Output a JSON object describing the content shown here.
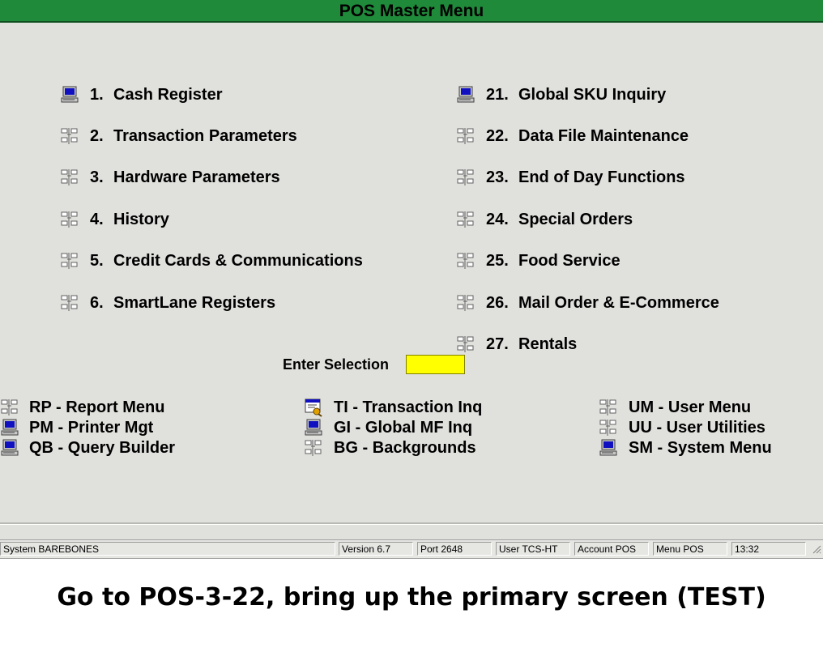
{
  "window": {
    "title": "POS Master Menu"
  },
  "menu_left": [
    {
      "num": "1.",
      "label": "Cash Register",
      "icon": "computer-icon"
    },
    {
      "num": "2.",
      "label": "Transaction Parameters",
      "icon": "submenu-icon"
    },
    {
      "num": "3.",
      "label": "Hardware Parameters",
      "icon": "submenu-icon"
    },
    {
      "num": "4.",
      "label": "History",
      "icon": "submenu-icon"
    },
    {
      "num": "5.",
      "label": "Credit Cards & Communications",
      "icon": "submenu-icon"
    },
    {
      "num": "6.",
      "label": "SmartLane Registers",
      "icon": "submenu-icon"
    }
  ],
  "menu_right": [
    {
      "num": "21.",
      "label": "Global SKU Inquiry",
      "icon": "computer-icon"
    },
    {
      "num": "22.",
      "label": "Data File Maintenance",
      "icon": "submenu-icon"
    },
    {
      "num": "23.",
      "label": "End of Day Functions",
      "icon": "submenu-icon"
    },
    {
      "num": "24.",
      "label": "Special Orders",
      "icon": "submenu-icon"
    },
    {
      "num": "25.",
      "label": "Food Service",
      "icon": "submenu-icon"
    },
    {
      "num": "26.",
      "label": "Mail Order & E-Commerce",
      "icon": "submenu-icon"
    },
    {
      "num": "27.",
      "label": "Rentals",
      "icon": "submenu-icon"
    }
  ],
  "selection": {
    "prompt": "Enter Selection",
    "value": ""
  },
  "shortcuts": {
    "col1": [
      {
        "label": "RP - Report Menu",
        "icon": "submenu-icon"
      },
      {
        "label": "PM - Printer Mgt",
        "icon": "computer-icon"
      },
      {
        "label": "QB - Query Builder",
        "icon": "computer-icon"
      }
    ],
    "col2": [
      {
        "label": "TI - Transaction Inq",
        "icon": "inquiry-icon"
      },
      {
        "label": "GI - Global MF Inq",
        "icon": "computer-icon"
      },
      {
        "label": "BG - Backgrounds",
        "icon": "submenu-icon"
      }
    ],
    "col3": [
      {
        "label": "UM - User Menu",
        "icon": "submenu-icon"
      },
      {
        "label": "UU - User Utilities",
        "icon": "submenu-icon"
      },
      {
        "label": "SM - System Menu",
        "icon": "computer-icon"
      }
    ]
  },
  "status": {
    "system": "System BAREBONES",
    "version": "Version 6.7",
    "port": "Port 2648",
    "user": "User TCS-HT",
    "account": "Account POS",
    "menu": "Menu POS",
    "time": "13:32"
  },
  "caption": "Go to POS-3-22, bring up the primary screen (TEST)",
  "colors": {
    "title_bar": "#1f8a3a",
    "background": "#e0e0dd",
    "selection_field": "#ffff00"
  }
}
